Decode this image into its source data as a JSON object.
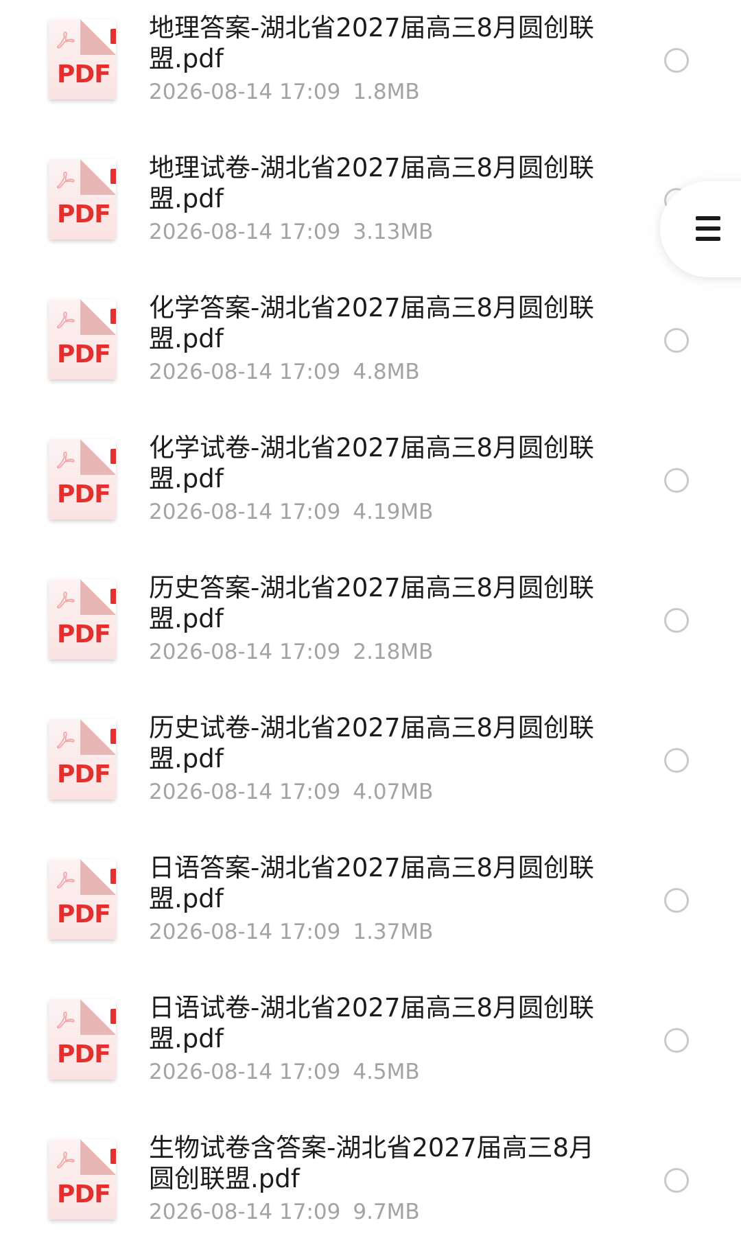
{
  "files": [
    {
      "name": "地理答案-湖北省2027届高三8月圆创联盟.pdf",
      "date": "2026-08-14 17:09",
      "size": "1.8MB",
      "icon": "pdf-file-icon",
      "icon_label": "PDF"
    },
    {
      "name": "地理试卷-湖北省2027届高三8月圆创联盟.pdf",
      "date": "2026-08-14 17:09",
      "size": "3.13MB",
      "icon": "pdf-file-icon",
      "icon_label": "PDF"
    },
    {
      "name": "化学答案-湖北省2027届高三8月圆创联盟.pdf",
      "date": "2026-08-14 17:09",
      "size": "4.8MB",
      "icon": "pdf-file-icon",
      "icon_label": "PDF"
    },
    {
      "name": "化学试卷-湖北省2027届高三8月圆创联盟.pdf",
      "date": "2026-08-14 17:09",
      "size": "4.19MB",
      "icon": "pdf-file-icon",
      "icon_label": "PDF"
    },
    {
      "name": "历史答案-湖北省2027届高三8月圆创联盟.pdf",
      "date": "2026-08-14 17:09",
      "size": "2.18MB",
      "icon": "pdf-file-icon",
      "icon_label": "PDF"
    },
    {
      "name": "历史试卷-湖北省2027届高三8月圆创联盟.pdf",
      "date": "2026-08-14 17:09",
      "size": "4.07MB",
      "icon": "pdf-file-icon",
      "icon_label": "PDF"
    },
    {
      "name": "日语答案-湖北省2027届高三8月圆创联盟.pdf",
      "date": "2026-08-14 17:09",
      "size": "1.37MB",
      "icon": "pdf-file-icon",
      "icon_label": "PDF"
    },
    {
      "name": "日语试卷-湖北省2027届高三8月圆创联盟.pdf",
      "date": "2026-08-14 17:09",
      "size": "4.5MB",
      "icon": "pdf-file-icon",
      "icon_label": "PDF"
    },
    {
      "name": "生物试卷含答案-湖北省2027届高三8月圆创联盟.pdf",
      "date": "2026-08-14 17:09",
      "size": "9.7MB",
      "icon": "pdf-file-icon",
      "icon_label": "PDF"
    }
  ],
  "floating_menu": {
    "icon": "hamburger-menu-icon"
  },
  "colors": {
    "pdf_red": "#e3302f",
    "meta_gray": "#a3a3a3",
    "title": "#1b1b1b",
    "radio_border": "#c9c9c9"
  }
}
